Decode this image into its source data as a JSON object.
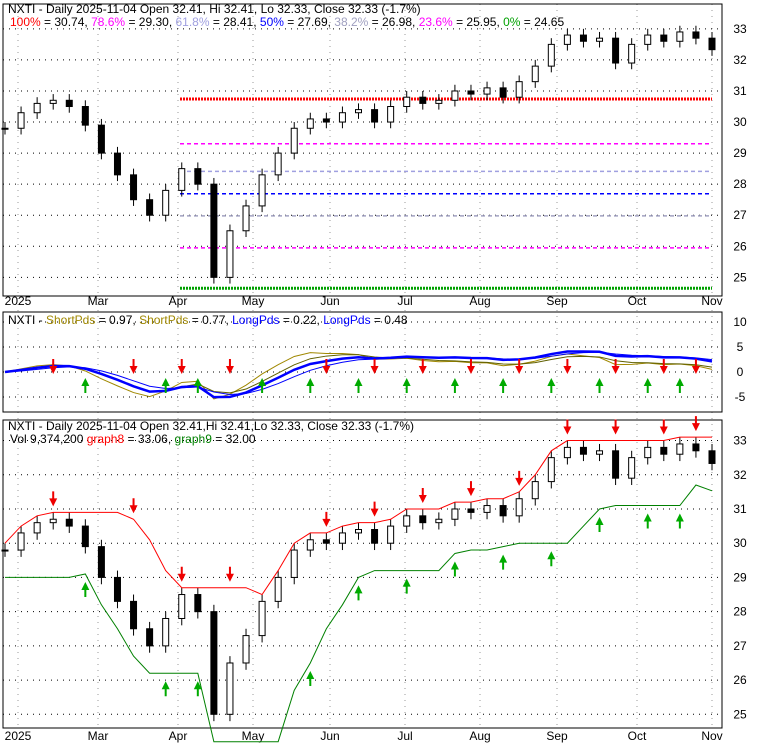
{
  "chart_data": [
    {
      "type": "candlestick",
      "title": "NXTI - Daily 2025-11-04 Open 32.41, Hi 32.41, Lo 32.33, Close 32.33 (-1.7%)",
      "fib_levels": [
        {
          "label": "100%",
          "value": 30.74,
          "color": "#ff0000"
        },
        {
          "label": "78.6%",
          "value": 29.3,
          "color": "#ff00ff"
        },
        {
          "label": "61.8%",
          "value": 28.41,
          "color": "#a0a0e0"
        },
        {
          "label": "50%",
          "value": 27.69,
          "color": "#0000ff"
        },
        {
          "label": "38.2%",
          "value": 26.98,
          "color": "#a0a0c0"
        },
        {
          "label": "23.6%",
          "value": 25.95,
          "color": "#ff00ff"
        },
        {
          "label": "0%",
          "value": 24.65,
          "color": "#00a000"
        }
      ],
      "y_ticks": [
        25,
        26,
        27,
        28,
        29,
        30,
        31,
        32,
        33
      ],
      "ylim": [
        24.4,
        33.8
      ]
    },
    {
      "type": "line",
      "title_prefix": "NXTI - ",
      "legend": [
        {
          "label": "ShortPds",
          "value": "0.97",
          "color": "#a08800"
        },
        {
          "label": "ShortPds",
          "value": "0.77",
          "color": "#a08800"
        },
        {
          "label": "LongPds",
          "value": "0.22",
          "color": "#0000ff"
        },
        {
          "label": "LongPds",
          "value": "0.48",
          "color": "#0000ff"
        }
      ],
      "y_ticks": [
        10,
        5,
        0,
        -5
      ],
      "ylim": [
        -8,
        12
      ]
    },
    {
      "type": "candlestick",
      "title": "NXTI - Daily 2025-11-04 Open 32.41,Hi 32.41,Lo 32.33, Close 32.33 (-1.7%)",
      "vol_label": "Vol 9,374,200",
      "graph8": {
        "label": "graph8",
        "value": "33.06",
        "color": "#ff0000"
      },
      "graph9": {
        "label": "graph9",
        "value": "32.00",
        "color": "#008000"
      },
      "y_ticks": [
        25,
        26,
        27,
        28,
        29,
        30,
        31,
        32,
        33
      ],
      "ylim": [
        24.6,
        33.6
      ]
    }
  ],
  "x_labels": [
    "2025",
    "Mar",
    "Apr",
    "May",
    "Jun",
    "Jul",
    "Aug",
    "Sep",
    "Oct",
    "Nov"
  ],
  "closes": [
    29.8,
    30.3,
    30.6,
    30.7,
    30.5,
    29.9,
    29.0,
    28.3,
    27.5,
    27.0,
    27.8,
    28.5,
    28.0,
    25.0,
    26.5,
    27.3,
    28.3,
    29.0,
    29.8,
    30.1,
    30.0,
    30.3,
    30.4,
    30.0,
    30.5,
    30.8,
    30.6,
    30.7,
    31.0,
    30.9,
    31.1,
    30.8,
    31.3,
    31.8,
    32.5,
    32.8,
    32.6,
    32.7,
    31.9,
    32.5,
    32.8,
    32.6,
    32.9,
    32.7,
    32.33
  ],
  "sell_signals": [
    3,
    8,
    11,
    14,
    20,
    23,
    26,
    29,
    32,
    35,
    38,
    41,
    43
  ],
  "buy_signals": [
    5,
    10,
    12,
    16,
    19,
    22,
    25,
    28,
    31,
    34,
    37,
    40,
    42
  ]
}
